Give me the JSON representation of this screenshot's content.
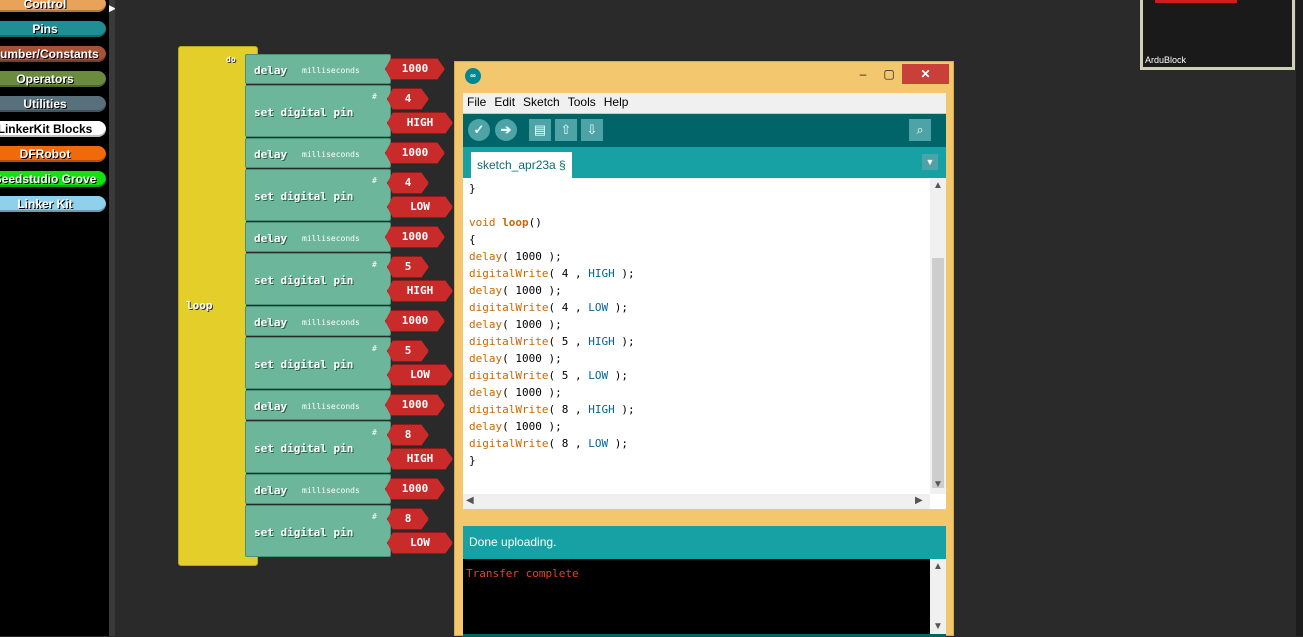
{
  "categories": [
    {
      "label": "Control",
      "color": "#e9a25a"
    },
    {
      "label": "Pins",
      "color": "#1f8f95"
    },
    {
      "label": "Number/Constants",
      "color": "#a65234"
    },
    {
      "label": "Operators",
      "color": "#6b8b3d"
    },
    {
      "label": "Utilities",
      "color": "#58707b"
    },
    {
      "label": "LinkerKit Blocks",
      "color": "#ffffff"
    },
    {
      "label": "DFRobot",
      "color": "#f06a0b"
    },
    {
      "label": "Seedstudio Grove",
      "color": "#14e114"
    },
    {
      "label": "Linker Kit",
      "color": "#8fd0ec"
    }
  ],
  "program": {
    "loop_label": "loop",
    "do_label": "do",
    "delay_label": "delay",
    "milliseconds_label": "milliseconds",
    "set_pin_label": "set digital pin",
    "hash_label": "#",
    "steps": [
      {
        "delay": "1000",
        "pin": "4",
        "state": "HIGH"
      },
      {
        "delay": "1000",
        "pin": "4",
        "state": "LOW"
      },
      {
        "delay": "1000",
        "pin": "5",
        "state": "HIGH"
      },
      {
        "delay": "1000",
        "pin": "5",
        "state": "LOW"
      },
      {
        "delay": "1000",
        "pin": "8",
        "state": "HIGH"
      },
      {
        "delay": "1000",
        "pin": "8",
        "state": "LOW"
      }
    ]
  },
  "ide": {
    "window_buttons": {
      "minimize": "–",
      "maximize": "▢",
      "close": "✕"
    },
    "menu": [
      "File",
      "Edit",
      "Sketch",
      "Tools",
      "Help"
    ],
    "tab": "sketch_apr23a §",
    "code_lines": [
      "}",
      "",
      "void loop()",
      "{",
      "delay( 1000 );",
      "digitalWrite( 4 , HIGH );",
      "delay( 1000 );",
      "digitalWrite( 4 , LOW );",
      "delay( 1000 );",
      "digitalWrite( 5 , HIGH );",
      "delay( 1000 );",
      "digitalWrite( 5 , LOW );",
      "delay( 1000 );",
      "digitalWrite( 8 , HIGH );",
      "delay( 1000 );",
      "digitalWrite( 8 , LOW );",
      "}"
    ],
    "status": "Done uploading.",
    "console": "Transfer complete"
  },
  "mini_window": {
    "label": "ArduBlock"
  }
}
